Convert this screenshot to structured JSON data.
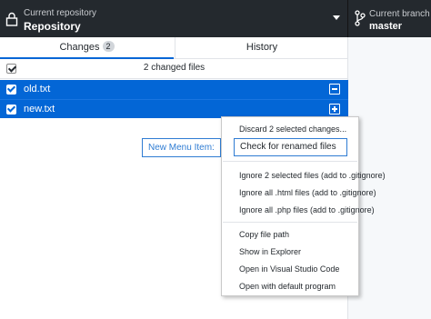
{
  "toolbar": {
    "repository": {
      "subtitle": "Current repository",
      "title": "Repository",
      "icon": "lock-icon"
    },
    "branch": {
      "subtitle": "Current branch",
      "title": "master",
      "icon": "git-branch-icon"
    }
  },
  "tabs": {
    "changes": {
      "label": "Changes",
      "count": "2"
    },
    "history": {
      "label": "History"
    }
  },
  "changes": {
    "summary": "2 changed files",
    "files": [
      {
        "name": "old.txt",
        "status_icon": "file-deleted-icon"
      },
      {
        "name": "new.txt",
        "status_icon": "file-added-icon"
      }
    ]
  },
  "annotation": {
    "label": "New Menu Item:"
  },
  "context_menu": {
    "items": [
      "Discard 2 selected changes...",
      "Check for renamed files",
      "Ignore 2 selected files (add to .gitignore)",
      "Ignore all .html files (add to .gitignore)",
      "Ignore all .php files (add to .gitignore)",
      "Copy file path",
      "Show in Explorer",
      "Open in Visual Studio Code",
      "Open with default program"
    ]
  },
  "colors": {
    "toolbar_bg": "#24292e",
    "selection_bg": "#0366d6",
    "highlight_border": "#2f7cd3"
  }
}
